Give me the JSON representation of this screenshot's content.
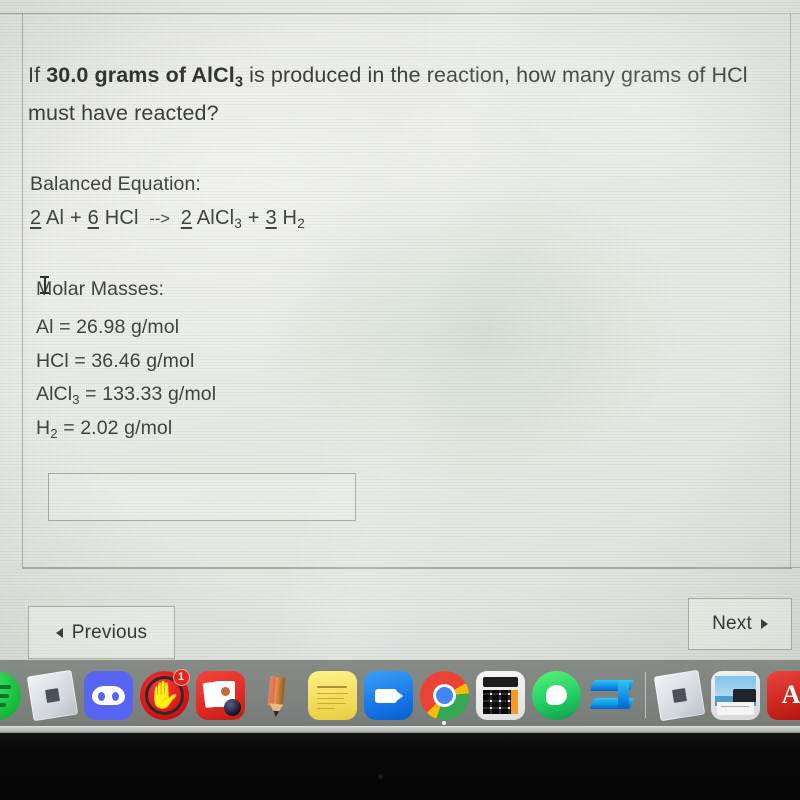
{
  "question": {
    "lead": "If ",
    "bold": "30.0 grams of AlCl",
    "bold_sub": "3",
    "rest": " is produced in the reaction, how many grams of HCl must have reacted?"
  },
  "balanced_equation": {
    "label": "Balanced Equation:",
    "terms": [
      {
        "coef": "2",
        "formula": "Al",
        "sub": ""
      },
      {
        "coef": "6",
        "formula": "HCl",
        "sub": ""
      },
      {
        "coef": "2",
        "formula": "AlCl",
        "sub": "3"
      },
      {
        "coef": "3",
        "formula": "H",
        "sub": "2"
      }
    ],
    "plus": "+",
    "arrow": "-->"
  },
  "molar_masses": {
    "label": "Molar Masses:",
    "rows": [
      {
        "species": "Al",
        "sub": "",
        "eq": "=",
        "value": "26.98",
        "unit": "g/mol"
      },
      {
        "species": "HCl",
        "sub": "",
        "eq": "=",
        "value": "36.46",
        "unit": "g/mol"
      },
      {
        "species": "AlCl",
        "sub": "3",
        "eq": "=",
        "value": "133.33",
        "unit": "g/mol"
      },
      {
        "species": "H",
        "sub": "2",
        "eq": "=",
        "value": "2.02",
        "unit": "g/mol"
      }
    ]
  },
  "answer_input": {
    "value": "",
    "placeholder": ""
  },
  "nav": {
    "previous_label": "Previous",
    "next_label": "Next"
  },
  "dock": {
    "items": [
      {
        "name": "spotify",
        "label": "Spotify",
        "badge": "",
        "running": false
      },
      {
        "name": "roblox",
        "label": "Roblox",
        "badge": "",
        "running": false
      },
      {
        "name": "discord",
        "label": "Discord",
        "badge": "",
        "running": false
      },
      {
        "name": "hand",
        "label": "Hand App",
        "badge": "1",
        "running": false
      },
      {
        "name": "photobooth",
        "label": "Photo Booth",
        "badge": "",
        "running": false
      },
      {
        "name": "pencil",
        "label": "Sketch",
        "badge": "",
        "running": false
      },
      {
        "name": "notes",
        "label": "Notes",
        "badge": "",
        "running": false
      },
      {
        "name": "facetime",
        "label": "FaceTime",
        "badge": "",
        "running": false
      },
      {
        "name": "chrome",
        "label": "Google Chrome",
        "badge": "",
        "running": true
      },
      {
        "name": "calculator",
        "label": "Calculator",
        "badge": "",
        "running": false
      },
      {
        "name": "whatsapp",
        "label": "WhatsApp",
        "badge": "",
        "running": false
      },
      {
        "name": "bluefiles",
        "label": "File Transfer",
        "badge": "",
        "running": false
      },
      {
        "name": "roblox2",
        "label": "Roblox",
        "badge": "",
        "running": false
      },
      {
        "name": "photos",
        "label": "Photos",
        "badge": "",
        "running": false
      },
      {
        "name": "acrobat",
        "label": "Acrobat",
        "badge": "",
        "running": false
      }
    ]
  },
  "colors": {
    "screen_bg": "#eceee9",
    "text": "#3f433f",
    "border": "#7d827a",
    "dock_bg": "#848884",
    "badge_red": "#e8251c"
  }
}
